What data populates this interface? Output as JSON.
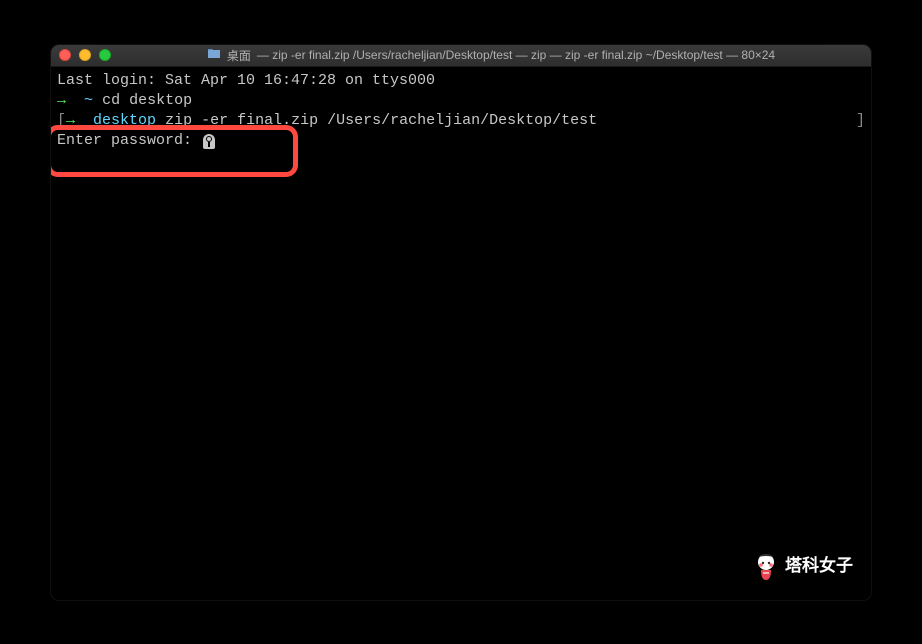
{
  "titlebar": {
    "folder_name": "桌面",
    "title": "— zip -er final.zip /Users/racheljian/Desktop/test — zip — zip -er final.zip ~/Desktop/test — 80×24"
  },
  "terminal": {
    "last_login": "Last login: Sat Apr 10 16:47:28 on ttys000",
    "prompt1_arrow": "→",
    "prompt1_tilde": "~",
    "prompt1_cmd": "cd desktop",
    "prompt2_bracket_l": "[",
    "prompt2_arrow": "→",
    "prompt2_dir": "desktop",
    "prompt2_cmd": "zip -er final.zip /Users/racheljian/Desktop/test",
    "prompt2_bracket_r": "]",
    "password_prompt": "Enter password: "
  },
  "watermark": {
    "text": "塔科女子"
  }
}
